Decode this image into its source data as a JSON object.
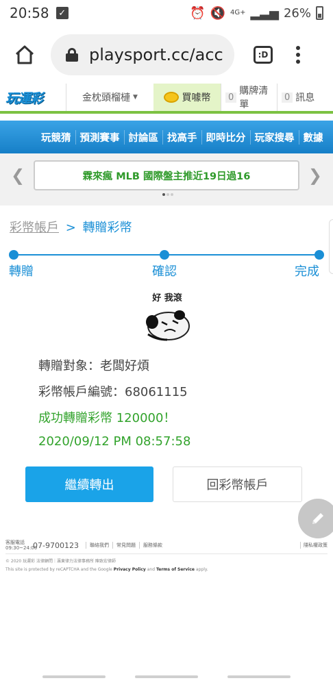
{
  "status_bar": {
    "time": "20:58",
    "network": "4G+",
    "battery": "26%"
  },
  "browser": {
    "url": "playsport.cc/acc",
    "tab_count": ":D"
  },
  "site_header": {
    "logo": "玩運彩",
    "user_name": "金枕頭榴槤",
    "buy_coins": "買噱幣",
    "cart_count": "0",
    "cart_label": "購牌清單",
    "msg_count": "0",
    "msg_label": "訊息"
  },
  "nav": [
    "玩競猜",
    "預測賽事",
    "討論區",
    "找高手",
    "即時比分",
    "玩家搜尋",
    "數據"
  ],
  "banner": {
    "text": "霖來瘋 MLB 國際盤主推近19日過16"
  },
  "breadcrumb": {
    "parent": "彩幣帳戶",
    "separator": ">",
    "current": "轉贈彩幣"
  },
  "steps": [
    "轉贈",
    "確認",
    "完成"
  ],
  "meme": {
    "caption": "好 我滾"
  },
  "result": {
    "recipient": "轉贈對象：老闆好煩",
    "account": "彩幣帳戶編號：68061115",
    "success": "成功轉贈彩幣 120000！",
    "timestamp": "2020/09/12 PM 08:57:58"
  },
  "buttons": {
    "continue": "繼續轉出",
    "back": "回彩幣帳戶"
  },
  "footer": {
    "service_label": "客服電話",
    "service_hours": "09:30~24:00",
    "phone": "07-9700123",
    "links": [
      "聯絡我們",
      "常見問題",
      "服務條款"
    ],
    "right_link": "隱私權政策",
    "copyright": "© 2020 玩運彩 法律顧問｜瀛東律力法律事務所 陳致宏律師",
    "captcha_pre": "This site is protected by reCAPTCHA and the Google",
    "captcha_privacy": "Privacy Policy",
    "captcha_and": "and",
    "captcha_terms": "Terms of Service",
    "captcha_post": "apply."
  },
  "colors": {
    "accent_blue": "#1a8fd6",
    "success_green": "#32a32c",
    "header_green": "#7cc242",
    "button_blue": "#1aa3e8"
  }
}
